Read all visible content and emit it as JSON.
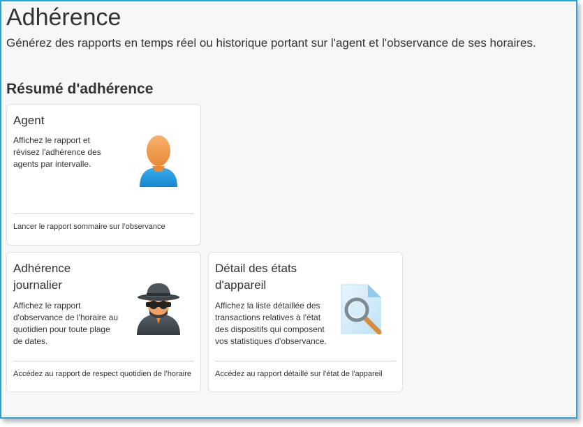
{
  "header": {
    "title": "Adhérence",
    "subtitle": "Générez des rapports en temps réel ou historique portant sur l'agent et l'observance de ses horaires."
  },
  "section": {
    "title": "Résumé d'adhérence"
  },
  "cards": {
    "agent": {
      "title": "Agent",
      "description": "Affichez le rapport et révisez l'adhérence des agents par intervalle.",
      "link": "Lancer le rapport sommaire sur l’observance",
      "icon": "user-icon"
    },
    "daily": {
      "title": "Adhérence journalier",
      "description": "Affichez le rapport d'observance de l'horaire au quotidien pour toute plage de dates.",
      "link": "Accédez au rapport de respect quotidien de l’horaire",
      "icon": "spy-icon"
    },
    "device": {
      "title": "Détail des états d'appareil",
      "description": "Affichez la liste détaillée des transactions relatives à l'état des dispositifs qui composent vos statistiques d'observance.",
      "link": "Accédez au rapport détaillé sur l'état de l'appareil",
      "icon": "document-search-icon"
    }
  },
  "colors": {
    "frame_border": "#2aa3d8",
    "background": "#f7f7f7",
    "card": "#ffffff"
  }
}
